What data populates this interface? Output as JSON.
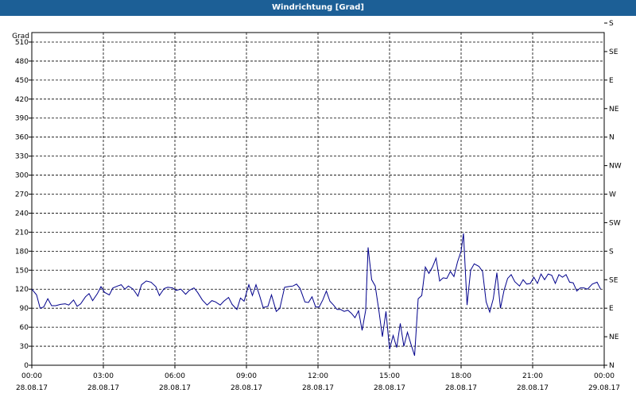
{
  "title": "Windrichtung [Grad]",
  "chart_data": {
    "type": "line",
    "title": "Windrichtung [Grad]",
    "ylabel": "Grad",
    "ylim": [
      0,
      525
    ],
    "yticks": [
      0,
      30,
      60,
      90,
      120,
      150,
      180,
      210,
      240,
      270,
      300,
      330,
      360,
      390,
      420,
      450,
      480,
      510
    ],
    "y2_labels": [
      {
        "value": 0,
        "label": "N"
      },
      {
        "value": 45,
        "label": "NE"
      },
      {
        "value": 90,
        "label": "E"
      },
      {
        "value": 135,
        "label": "SE"
      },
      {
        "value": 180,
        "label": "S"
      },
      {
        "value": 225,
        "label": "SW"
      },
      {
        "value": 270,
        "label": "W"
      },
      {
        "value": 315,
        "label": "NW"
      },
      {
        "value": 360,
        "label": "N"
      },
      {
        "value": 405,
        "label": "NE"
      },
      {
        "value": 450,
        "label": "E"
      },
      {
        "value": 495,
        "label": "SE"
      },
      {
        "value": 540,
        "label": "S"
      }
    ],
    "xlim": [
      0,
      24
    ],
    "x_unit": "hours from 28.08.17 00:00",
    "xticks": [
      {
        "hour": 0,
        "time": "00:00",
        "date": "28.08.17"
      },
      {
        "hour": 3,
        "time": "03:00",
        "date": "28.08.17"
      },
      {
        "hour": 6,
        "time": "06:00",
        "date": "28.08.17"
      },
      {
        "hour": 9,
        "time": "09:00",
        "date": "28.08.17"
      },
      {
        "hour": 12,
        "time": "12:00",
        "date": "28.08.17"
      },
      {
        "hour": 15,
        "time": "15:00",
        "date": "28.08.17"
      },
      {
        "hour": 18,
        "time": "18:00",
        "date": "28.08.17"
      },
      {
        "hour": 21,
        "time": "21:00",
        "date": "28.08.17"
      },
      {
        "hour": 24,
        "time": "00:00",
        "date": "29.08.17"
      }
    ],
    "grid": true,
    "series": [
      {
        "color": "#00008b",
        "points": [
          [
            0.0,
            120
          ],
          [
            0.2,
            111
          ],
          [
            0.35,
            90
          ],
          [
            0.5,
            92
          ],
          [
            0.67,
            105
          ],
          [
            0.83,
            94
          ],
          [
            1.0,
            94
          ],
          [
            1.2,
            96
          ],
          [
            1.4,
            97
          ],
          [
            1.55,
            95
          ],
          [
            1.75,
            103
          ],
          [
            1.9,
            93
          ],
          [
            2.05,
            97
          ],
          [
            2.25,
            108
          ],
          [
            2.4,
            113
          ],
          [
            2.55,
            102
          ],
          [
            2.75,
            113
          ],
          [
            2.9,
            124
          ],
          [
            3.05,
            115
          ],
          [
            3.25,
            111
          ],
          [
            3.4,
            122
          ],
          [
            3.6,
            125
          ],
          [
            3.75,
            127
          ],
          [
            3.9,
            120
          ],
          [
            4.05,
            125
          ],
          [
            4.25,
            120
          ],
          [
            4.45,
            109
          ],
          [
            4.6,
            127
          ],
          [
            4.8,
            133
          ],
          [
            5.0,
            131
          ],
          [
            5.2,
            124
          ],
          [
            5.35,
            110
          ],
          [
            5.55,
            121
          ],
          [
            5.7,
            123
          ],
          [
            5.9,
            122
          ],
          [
            6.05,
            118
          ],
          [
            6.25,
            120
          ],
          [
            6.45,
            112
          ],
          [
            6.6,
            118
          ],
          [
            6.8,
            122
          ],
          [
            6.95,
            115
          ],
          [
            7.15,
            103
          ],
          [
            7.35,
            95
          ],
          [
            7.55,
            102
          ],
          [
            7.7,
            100
          ],
          [
            7.9,
            95
          ],
          [
            8.05,
            101
          ],
          [
            8.25,
            107
          ],
          [
            8.4,
            96
          ],
          [
            8.6,
            88
          ],
          [
            8.75,
            106
          ],
          [
            8.9,
            101
          ],
          [
            9.1,
            127
          ],
          [
            9.25,
            110
          ],
          [
            9.4,
            127
          ],
          [
            9.55,
            110
          ],
          [
            9.7,
            91
          ],
          [
            9.9,
            93
          ],
          [
            10.05,
            111
          ],
          [
            10.25,
            85
          ],
          [
            10.4,
            90
          ],
          [
            10.6,
            123
          ],
          [
            10.75,
            124
          ],
          [
            10.95,
            125
          ],
          [
            11.1,
            128
          ],
          [
            11.25,
            121
          ],
          [
            11.45,
            100
          ],
          [
            11.6,
            99
          ],
          [
            11.75,
            108
          ],
          [
            11.9,
            92
          ],
          [
            12.05,
            92
          ],
          [
            12.2,
            103
          ],
          [
            12.35,
            117
          ],
          [
            12.5,
            101
          ],
          [
            12.65,
            95
          ],
          [
            12.8,
            88
          ],
          [
            12.95,
            88
          ],
          [
            13.1,
            85
          ],
          [
            13.25,
            87
          ],
          [
            13.4,
            82
          ],
          [
            13.55,
            75
          ],
          [
            13.7,
            86
          ],
          [
            13.85,
            55
          ],
          [
            14.0,
            87
          ],
          [
            14.1,
            186
          ],
          [
            14.25,
            135
          ],
          [
            14.4,
            125
          ],
          [
            14.55,
            87
          ],
          [
            14.7,
            45
          ],
          [
            14.85,
            85
          ],
          [
            15.0,
            25
          ],
          [
            15.15,
            47
          ],
          [
            15.3,
            28
          ],
          [
            15.45,
            66
          ],
          [
            15.6,
            30
          ],
          [
            15.75,
            52
          ],
          [
            15.9,
            33
          ],
          [
            16.05,
            15
          ],
          [
            16.2,
            105
          ],
          [
            16.35,
            110
          ],
          [
            16.5,
            155
          ],
          [
            16.65,
            145
          ],
          [
            16.8,
            155
          ],
          [
            16.95,
            169
          ],
          [
            17.1,
            133
          ],
          [
            17.25,
            138
          ],
          [
            17.4,
            137
          ],
          [
            17.55,
            148
          ],
          [
            17.7,
            140
          ],
          [
            17.85,
            163
          ],
          [
            18.0,
            180
          ],
          [
            18.1,
            208
          ],
          [
            18.25,
            95
          ],
          [
            18.4,
            150
          ],
          [
            18.55,
            160
          ],
          [
            18.75,
            156
          ],
          [
            18.9,
            148
          ],
          [
            19.05,
            100
          ],
          [
            19.2,
            84
          ],
          [
            19.35,
            105
          ],
          [
            19.5,
            146
          ],
          [
            19.65,
            90
          ],
          [
            19.8,
            118
          ],
          [
            19.95,
            137
          ],
          [
            20.1,
            143
          ],
          [
            20.25,
            132
          ],
          [
            20.45,
            125
          ],
          [
            20.6,
            135
          ],
          [
            20.75,
            128
          ],
          [
            20.9,
            129
          ],
          [
            21.05,
            139
          ],
          [
            21.2,
            129
          ],
          [
            21.35,
            144
          ],
          [
            21.5,
            135
          ],
          [
            21.65,
            144
          ],
          [
            21.8,
            142
          ],
          [
            21.95,
            129
          ],
          [
            22.1,
            143
          ],
          [
            22.25,
            139
          ],
          [
            22.4,
            143
          ],
          [
            22.55,
            131
          ],
          [
            22.7,
            130
          ],
          [
            22.85,
            117
          ],
          [
            23.0,
            122
          ],
          [
            23.15,
            122
          ],
          [
            23.3,
            120
          ],
          [
            23.5,
            128
          ],
          [
            23.7,
            131
          ],
          [
            23.85,
            120
          ]
        ]
      }
    ]
  }
}
